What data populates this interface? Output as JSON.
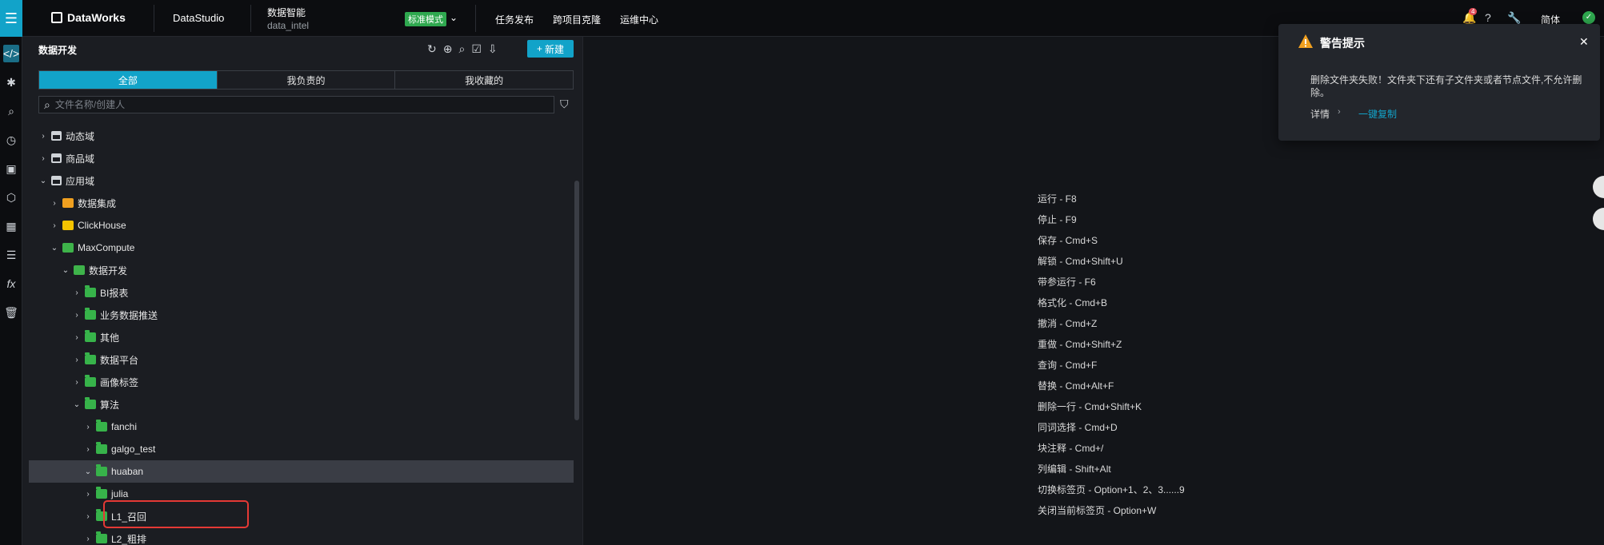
{
  "topbar": {
    "brand": "DataWorks",
    "studio": "DataStudio",
    "workspace_name": "数据智能",
    "workspace_id": "data_intel",
    "mode": "标准模式",
    "nav": [
      "任务发布",
      "跨项目克隆",
      "运维中心"
    ],
    "notif_count": "4",
    "lang": "简体"
  },
  "sidebar": {
    "title": "数据开发",
    "new_label": "新建",
    "tabs": [
      "全部",
      "我负责的",
      "我收藏的"
    ],
    "search_placeholder": "文件名称/创建人",
    "tree": [
      {
        "label": "动态域",
        "type": "domain"
      },
      {
        "label": "商品域",
        "type": "domain"
      },
      {
        "label": "应用域",
        "type": "domain"
      },
      {
        "label": "数据集成",
        "type": "integ"
      },
      {
        "label": "ClickHouse",
        "type": "ch"
      },
      {
        "label": "MaxCompute",
        "type": "mc"
      },
      {
        "label": "数据开发",
        "type": "dev"
      },
      {
        "label": "BI报表",
        "type": "folder"
      },
      {
        "label": "业务数据推送",
        "type": "folder"
      },
      {
        "label": "其他",
        "type": "folder"
      },
      {
        "label": "数据平台",
        "type": "folder"
      },
      {
        "label": "画像标签",
        "type": "folder"
      },
      {
        "label": "算法",
        "type": "folder"
      },
      {
        "label": "fanchi",
        "type": "folder"
      },
      {
        "label": "galgo_test",
        "type": "folder"
      },
      {
        "label": "huaban",
        "type": "folder"
      },
      {
        "label": "julia",
        "type": "folder"
      },
      {
        "label": "L1_召回",
        "type": "folder"
      },
      {
        "label": "L2_粗排",
        "type": "folder"
      }
    ]
  },
  "shortcuts": [
    "运行 - F8",
    "停止 - F9",
    "保存 - Cmd+S",
    "解锁 - Cmd+Shift+U",
    "带参运行 - F6",
    "格式化 - Cmd+B",
    "撤消 - Cmd+Z",
    "重做 - Cmd+Shift+Z",
    "查询 - Cmd+F",
    "替换 - Cmd+Alt+F",
    "删除一行 - Cmd+Shift+K",
    "同词选择 - Cmd+D",
    "块注释 - Cmd+/",
    "列编辑 - Shift+Alt",
    "切换标签页 - Option+1、2、3......9",
    "关闭当前标签页 - Option+W"
  ],
  "toast": {
    "title": "警告提示",
    "message": "删除文件夹失败！文件夹下还有子文件夹或者节点文件,不允许删除。",
    "detail": "详情",
    "copy": "一键复制"
  },
  "colors": {
    "accent": "#12a3c9",
    "folder": "#37b34a",
    "warning": "#f0a020",
    "highlight": "#e53935"
  }
}
